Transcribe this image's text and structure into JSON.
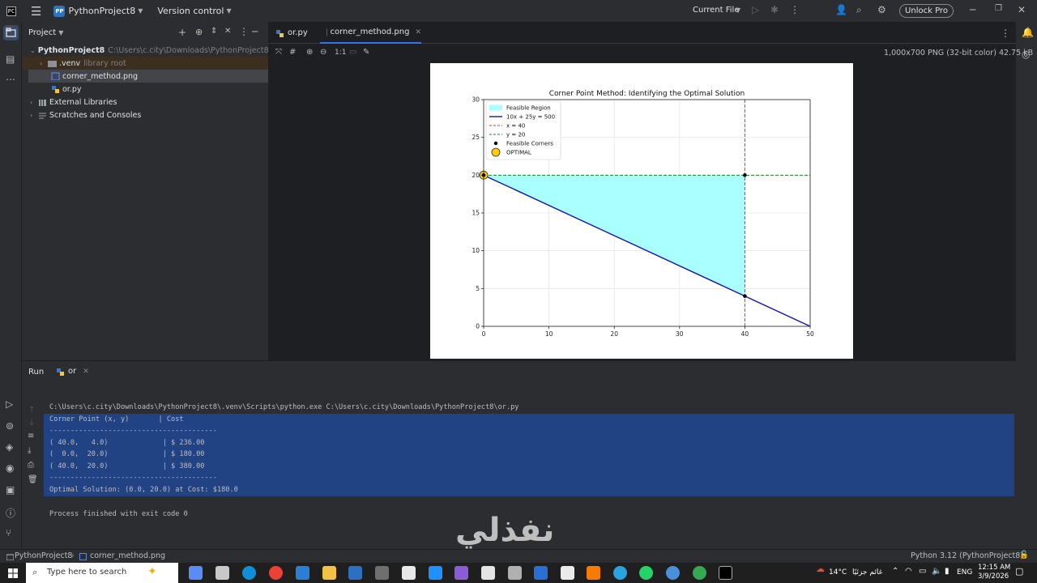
{
  "titlebar": {
    "project_badge": "PP",
    "project_name": "PythonProject8",
    "vcs": "Version control",
    "run_config": "Current File",
    "unlock": "Unlock Pro"
  },
  "project_panel": {
    "title": "Project",
    "tree": [
      {
        "label": "PythonProject8",
        "path": "C:\\Users\\c.city\\Downloads\\PythonProject8"
      },
      {
        "label": ".venv",
        "hint": "library root"
      },
      {
        "label": "corner_method.png"
      },
      {
        "label": "or.py"
      },
      {
        "label": "External Libraries"
      },
      {
        "label": "Scratches and Consoles"
      }
    ]
  },
  "editor": {
    "tabs": [
      {
        "label": "or.py"
      },
      {
        "label": "corner_method.png"
      }
    ],
    "image_info": "1,000x700 PNG (32-bit color) 42.75 kB",
    "zoom_label": "1:1"
  },
  "chart_data": {
    "type": "line",
    "title": "Corner Point Method: Identifying the Optimal Solution",
    "xlim": [
      0,
      50
    ],
    "ylim": [
      0,
      30
    ],
    "xticks": [
      0,
      10,
      20,
      30,
      40,
      50
    ],
    "yticks": [
      0,
      5,
      10,
      15,
      20,
      25,
      30
    ],
    "grid": true,
    "legend_position": "top-left",
    "legend": [
      "Feasible Region",
      "10x + 25y = 500",
      "x = 40",
      "y = 20",
      "Feasible Corners",
      "OPTIMAL"
    ],
    "feasible_region": [
      [
        0,
        20
      ],
      [
        40,
        20
      ],
      [
        40,
        4
      ]
    ],
    "constraint_line": [
      [
        0,
        20
      ],
      [
        50,
        0
      ]
    ],
    "vertical_line_x": 40,
    "horizontal_line_y": 20,
    "corners": [
      [
        40,
        4
      ],
      [
        0,
        20
      ],
      [
        40,
        20
      ]
    ],
    "optimal": [
      0,
      20
    ],
    "colors": {
      "region": "#aaffff",
      "constraint": "#1010cc",
      "vline": "#e03030",
      "hline": "#208020",
      "corner": "#000000",
      "optimal": "#ffcc00"
    }
  },
  "run_panel": {
    "tab_run": "Run",
    "tab_config": "or",
    "command": "C:\\Users\\c.city\\Downloads\\PythonProject8\\.venv\\Scripts\\python.exe C:\\Users\\c.city\\Downloads\\PythonProject8\\or.py",
    "lines": [
      "Corner Point (x, y)       | Cost",
      "----------------------------------------",
      "( 40.0,   4.0)             | $ 236.00",
      "(  0.0,  20.0)             | $ 180.00",
      "( 40.0,  20.0)             | $ 380.00",
      "----------------------------------------",
      "Optimal Solution: (0.0, 20.0) at Cost: $180.0"
    ],
    "exit": "Process finished with exit code 0"
  },
  "statusbar": {
    "crumb_project": "PythonProject8",
    "crumb_file": "corner_method.png",
    "interpreter": "Python 3.12 (PythonProject8)"
  },
  "taskbar": {
    "search_placeholder": "Type here to search",
    "weather_temp": "14°C",
    "weather_text": "غائم جزئيًا",
    "lang": "ENG",
    "time": "12:15 AM",
    "date": "3/9/2026"
  },
  "watermark": "نفذلي"
}
